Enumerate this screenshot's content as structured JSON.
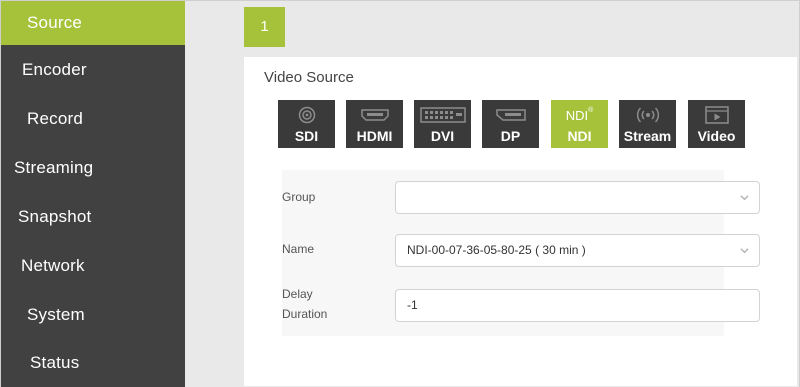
{
  "sidebar": {
    "items": [
      {
        "label": "Source",
        "active": true
      },
      {
        "label": "Encoder",
        "active": false
      },
      {
        "label": "Record",
        "active": false
      },
      {
        "label": "Streaming",
        "active": false
      },
      {
        "label": "Snapshot",
        "active": false
      },
      {
        "label": "Network",
        "active": false
      },
      {
        "label": "System",
        "active": false
      },
      {
        "label": "Status",
        "active": false
      }
    ]
  },
  "main": {
    "page_tab": "1",
    "panel_title": "Video Source",
    "sources": [
      {
        "label": "SDI",
        "icon": "sdi-icon",
        "active": false
      },
      {
        "label": "HDMI",
        "icon": "hdmi-icon",
        "active": false
      },
      {
        "label": "DVI",
        "icon": "dvi-icon",
        "active": false
      },
      {
        "label": "DP",
        "icon": "dp-icon",
        "active": false
      },
      {
        "label": "NDI",
        "icon": "ndi-logo-icon",
        "icon_text": "NDI",
        "active": true
      },
      {
        "label": "Stream",
        "icon": "stream-icon",
        "active": false
      },
      {
        "label": "Video",
        "icon": "video-icon",
        "active": false
      }
    ],
    "form": {
      "group_label": "Group",
      "group_value": "",
      "name_label": "Name",
      "name_value": "NDI-00-07-36-05-80-25 ( 30 min )",
      "delay_label_line1": "Delay",
      "delay_label_line2": "Duration",
      "delay_value": "-1"
    }
  },
  "colors": {
    "accent": "#a6c13a",
    "sidebar_bg": "#414141",
    "button_bg": "#3a3a3a",
    "page_bg": "#e9e9e9"
  }
}
